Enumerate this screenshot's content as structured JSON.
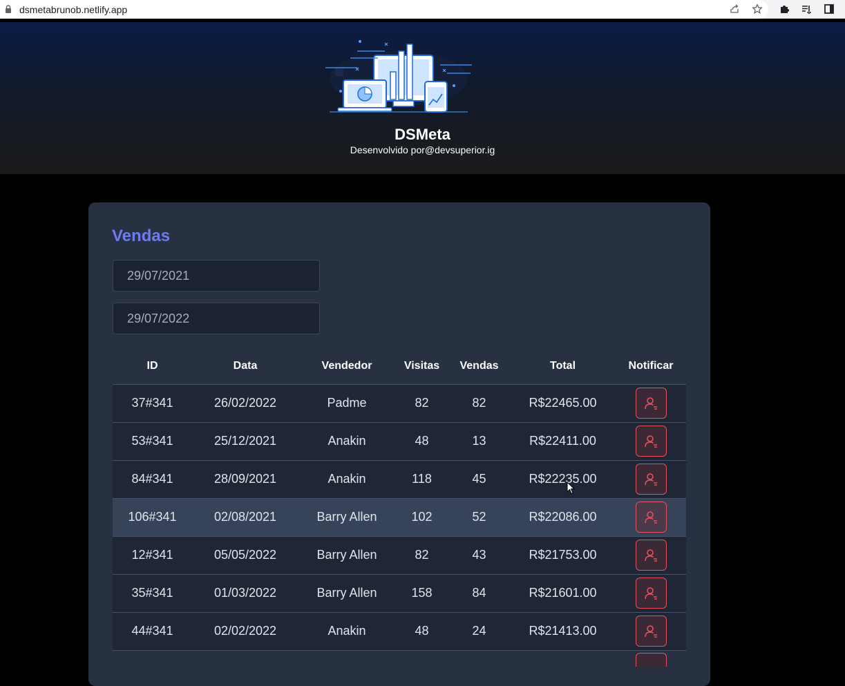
{
  "browser": {
    "url": "dsmetabrunob.netlify.app"
  },
  "header": {
    "brand": "DSMeta",
    "credit": "Desenvolvido por@devsuperior.ig"
  },
  "sales": {
    "title": "Vendas",
    "min_date": "29/07/2021",
    "max_date": "29/07/2022",
    "columns": [
      "ID",
      "Data",
      "Vendedor",
      "Visitas",
      "Vendas",
      "Total",
      "Notificar"
    ],
    "rows": [
      {
        "id": "37#341",
        "date": "26/02/2022",
        "seller": "Padme",
        "visits": "82",
        "deals": "82",
        "total": "R$22465.00"
      },
      {
        "id": "53#341",
        "date": "25/12/2021",
        "seller": "Anakin",
        "visits": "48",
        "deals": "13",
        "total": "R$22411.00"
      },
      {
        "id": "84#341",
        "date": "28/09/2021",
        "seller": "Anakin",
        "visits": "118",
        "deals": "45",
        "total": "R$22235.00"
      },
      {
        "id": "106#341",
        "date": "02/08/2021",
        "seller": "Barry Allen",
        "visits": "102",
        "deals": "52",
        "total": "R$22086.00"
      },
      {
        "id": "12#341",
        "date": "05/05/2022",
        "seller": "Barry Allen",
        "visits": "82",
        "deals": "43",
        "total": "R$21753.00"
      },
      {
        "id": "35#341",
        "date": "01/03/2022",
        "seller": "Barry Allen",
        "visits": "158",
        "deals": "84",
        "total": "R$21601.00"
      },
      {
        "id": "44#341",
        "date": "02/02/2022",
        "seller": "Anakin",
        "visits": "48",
        "deals": "24",
        "total": "R$21413.00"
      }
    ]
  },
  "icons": {
    "notify": "user-notify-icon",
    "lock": "lock-icon",
    "share": "share-icon",
    "star": "star-icon",
    "extensions": "puzzle-icon",
    "reading_list": "reading-list-icon",
    "side_panel": "side-panel-icon"
  },
  "colors": {
    "accent": "#6c7cf0",
    "notify_border": "#e5515d",
    "card_bg": "#283142"
  }
}
